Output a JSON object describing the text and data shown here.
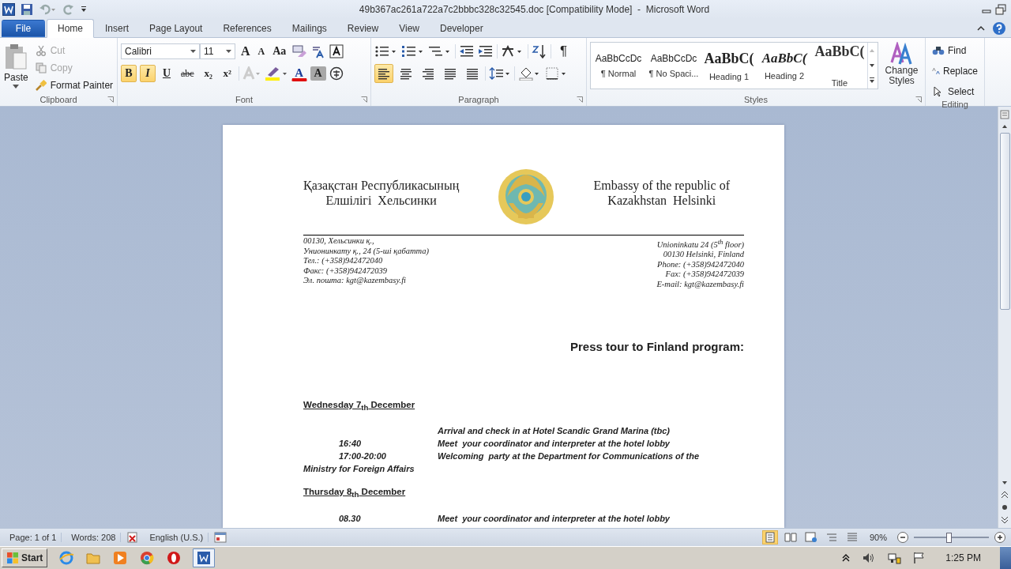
{
  "window": {
    "title": "49b367ac261a722a7c2bbbc328c32545.doc [Compatibility Mode]  -  Microsoft Word"
  },
  "tabs": [
    {
      "label": "File",
      "kind": "file",
      "selected": false
    },
    {
      "label": "Home",
      "kind": "tab",
      "selected": true
    },
    {
      "label": "Insert",
      "kind": "tab",
      "selected": false
    },
    {
      "label": "Page Layout",
      "kind": "tab",
      "selected": false
    },
    {
      "label": "References",
      "kind": "tab",
      "selected": false
    },
    {
      "label": "Mailings",
      "kind": "tab",
      "selected": false
    },
    {
      "label": "Review",
      "kind": "tab",
      "selected": false
    },
    {
      "label": "View",
      "kind": "tab",
      "selected": false
    },
    {
      "label": "Developer",
      "kind": "tab",
      "selected": false
    }
  ],
  "clipboard": {
    "label": "Clipboard",
    "paste": "Paste",
    "items": [
      {
        "label": "Cut",
        "kind": "cut",
        "disabled": true
      },
      {
        "label": "Copy",
        "kind": "copy",
        "disabled": true
      },
      {
        "label": "Format Painter",
        "kind": "painter",
        "disabled": false
      }
    ]
  },
  "font": {
    "label": "Font",
    "name": "Calibri",
    "size": "11",
    "grow": "A",
    "shrink": "A",
    "case": "Aa",
    "toggles": [
      {
        "glyph": "B",
        "kind": "bold",
        "on": true
      },
      {
        "glyph": "I",
        "kind": "italic",
        "on": true
      },
      {
        "glyph": "U",
        "kind": "underline",
        "on": false
      },
      {
        "glyph": "abc",
        "kind": "strike",
        "on": false
      },
      {
        "glyph": "x₂",
        "kind": "sub",
        "on": false
      },
      {
        "glyph": "x²",
        "kind": "sup",
        "on": false
      }
    ],
    "color_glyph": "A",
    "shade_glyph": "A"
  },
  "paragraph": {
    "label": "Paragraph",
    "pilcrow": "¶",
    "align_buttons": [
      {
        "kind": "left",
        "on": true
      },
      {
        "kind": "center",
        "on": false
      },
      {
        "kind": "right",
        "on": false
      },
      {
        "kind": "justify",
        "on": false
      },
      {
        "kind": "distributed",
        "on": false
      }
    ]
  },
  "styles": {
    "label": "Styles",
    "items": [
      {
        "preview": "AaBbCcDc",
        "name": "¶ Normal",
        "kind": "plain"
      },
      {
        "preview": "AaBbCcDc",
        "name": "¶ No Spaci...",
        "kind": "plain"
      },
      {
        "preview": "AaBbC(",
        "name": "Heading 1",
        "kind": "h1"
      },
      {
        "preview": "AaBbC(",
        "name": "Heading 2",
        "kind": "h2"
      },
      {
        "preview": "AaBbC(",
        "name": "Title",
        "kind": "title"
      }
    ],
    "change": "Change Styles"
  },
  "editing": {
    "label": "Editing",
    "items": [
      "Find",
      "Replace",
      "Select"
    ]
  },
  "document": {
    "header_left": [
      "Қазақстан Республикасының",
      "Елшілігі  Хельсинки"
    ],
    "header_right": [
      "Embassy of the republic of",
      "Kazakhstan  Helsinki"
    ],
    "address_left": [
      "00130, Хельсинки қ.,",
      "Унионинкату қ., 24 (5-ші қабатта)",
      "Тел.:  (+358)942472040",
      "Факс:  (+358)942472039",
      "Эл. пошта: kgt@kazembasy.fi"
    ],
    "address_right": [
      "Unioninkatu 24 (5$^{th}$ floor)",
      "00130 Helsinki, Finland",
      "Phone:  (+358)942472040",
      "Fax:  (+358)942472039",
      "E-mail: kgt@kazembasy.fi"
    ],
    "title": "Press tour to Finland program:",
    "days": [
      {
        "heading": "Wednesday 7$_{th}$ December",
        "entries": [
          {
            "text": "Arrival and check in at Hotel Scandic Grand Marina (tbc)"
          },
          {
            "time": "16:40",
            "text": "Meet  your coordinator and interpreter at the hotel lobby"
          },
          {
            "time": "17:00-20:00",
            "text": "Welcoming  party at the Department for Communications of the Ministry for Foreign Affairs"
          }
        ]
      },
      {
        "heading": "Thursday  8$_{th}$ December",
        "entries": [
          {
            "time": "08.30",
            "text": "Meet  your coordinator and interpreter at the hotel lobby"
          }
        ]
      }
    ]
  },
  "status_bar": {
    "page": "Page: 1 of 1",
    "words": "Words: 208",
    "language": "English (U.S.)",
    "zoom": "90%",
    "level": 0.47
  },
  "taskbar": {
    "start": "Start",
    "clock": "1:25 PM"
  }
}
